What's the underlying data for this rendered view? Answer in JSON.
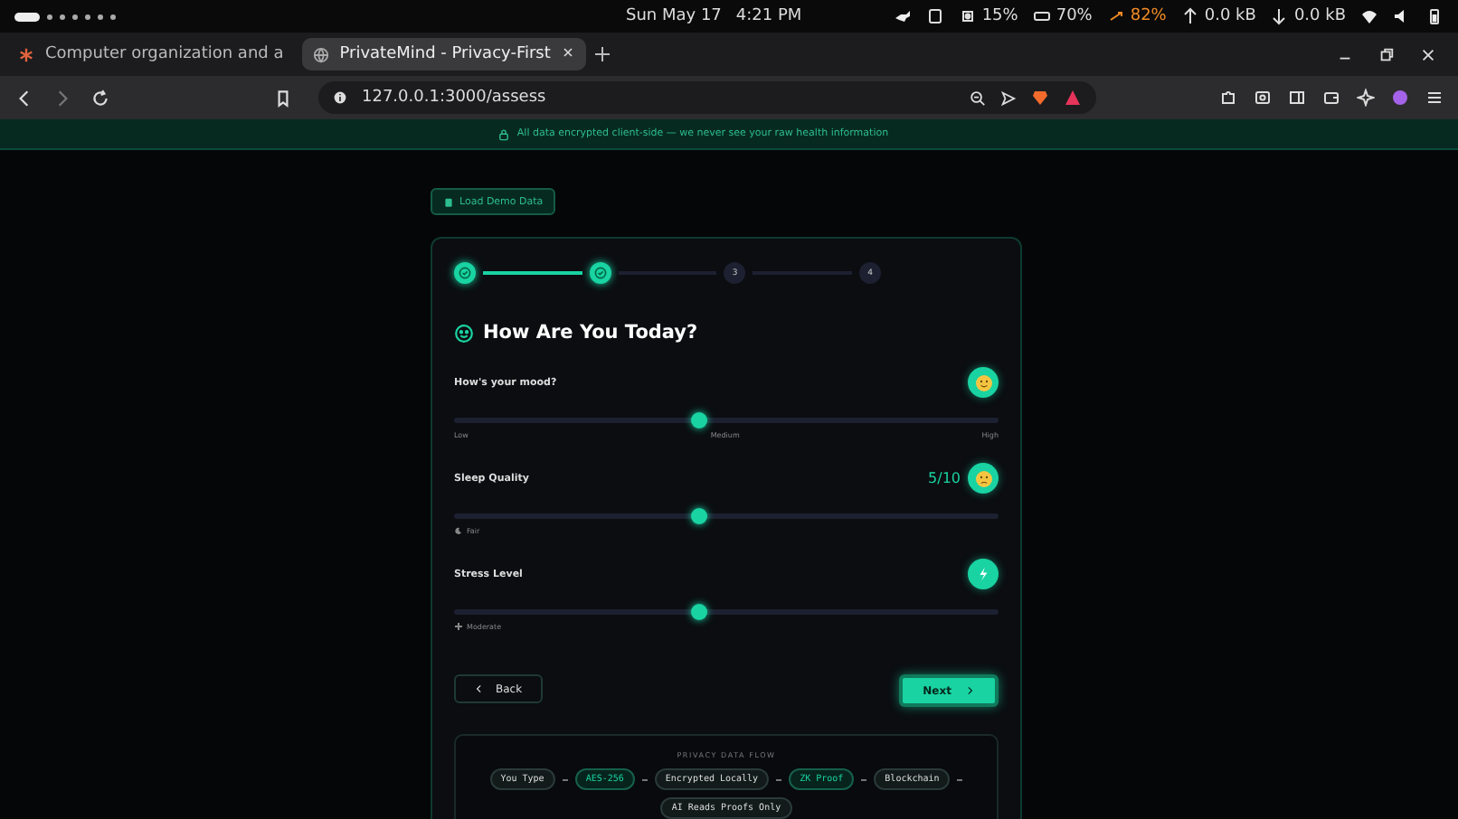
{
  "system_bar": {
    "date": "Sun May 17",
    "time": "4:21 PM",
    "cpu": "15%",
    "memory": "70%",
    "swap": "82%",
    "upload": "0.0 kB",
    "download": "0.0 kB"
  },
  "browser_tabs": [
    {
      "title": "Computer organization and a",
      "selected": false
    },
    {
      "title": "PrivateMind - Privacy-First",
      "selected": true
    }
  ],
  "address_bar": {
    "url": "127.0.0.1:3000/assess"
  },
  "banner": {
    "text": "All data encrypted client-side — we never see your raw health information"
  },
  "demo_button": {
    "label": "Load Demo Data"
  },
  "steps": [
    {
      "done": true
    },
    {
      "done": true
    },
    {
      "label": "3",
      "done": false
    },
    {
      "label": "4",
      "done": false
    }
  ],
  "section_title": "How Are You Today?",
  "sliders": [
    {
      "kind": "mood",
      "label": "How's your mood?",
      "level": 0.45,
      "scale": [
        "Low",
        "Medium",
        "High"
      ]
    },
    {
      "kind": "sleep",
      "label": "Sleep Quality",
      "reading": "5/10",
      "level": 0.45,
      "hint": "Fair"
    },
    {
      "kind": "stress",
      "label": "Stress Level",
      "level": 0.45,
      "hint": "Moderate"
    }
  ],
  "back_button": {
    "label": "Back"
  },
  "next_button": {
    "label": "Next"
  },
  "privacy_flow": {
    "title": "PRIVACY DATA FLOW",
    "steps": [
      {
        "label": "You Type",
        "kind": "plain"
      },
      {
        "label": "AES-256",
        "kind": "accent"
      },
      {
        "label": "Encrypted Locally",
        "kind": "plain"
      },
      {
        "label": "ZK Proof",
        "kind": "accent"
      },
      {
        "label": "Blockchain",
        "kind": "plain"
      },
      {
        "label": "AI Reads Proofs Only",
        "kind": "plain"
      }
    ]
  }
}
